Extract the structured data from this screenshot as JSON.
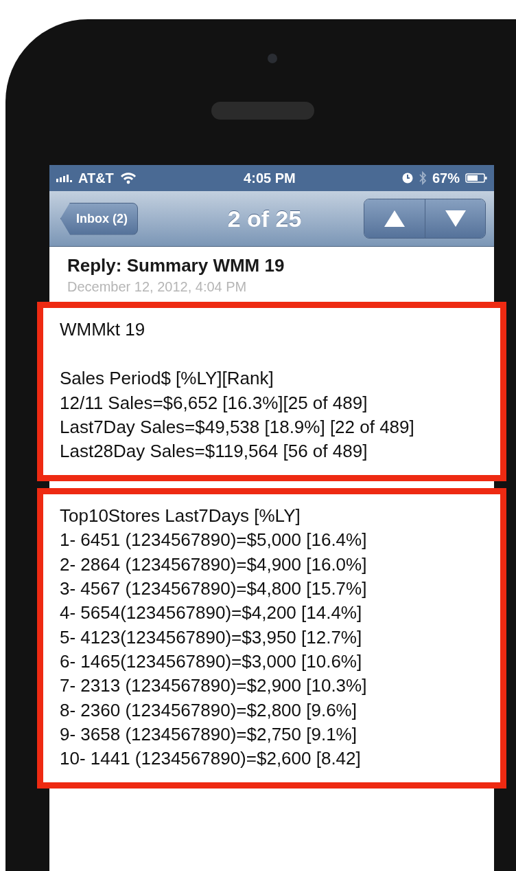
{
  "status_bar": {
    "carrier": "AT&T",
    "time": "4:05 PM",
    "battery": "67%"
  },
  "nav": {
    "back_button": "Inbox (2)",
    "title": "2 of 25"
  },
  "message": {
    "subject": "Reply: Summary WMM 19",
    "date": "December 12, 2012, 4:04 PM",
    "sections": [
      {
        "paragraphs": [
          [
            "WMMkt 19"
          ],
          [
            "Sales Period$ [%LY][Rank]",
            "12/11 Sales=$6,652 [16.3%][25 of 489]",
            "Last7Day Sales=$49,538 [18.9%] [22 of 489]",
            "Last28Day Sales=$119,564 [56 of 489]"
          ]
        ]
      },
      {
        "paragraphs": [
          [
            "Top10Stores Last7Days [%LY]",
            "1- 6451 (1234567890)=$5,000 [16.4%]",
            "2- 2864 (1234567890)=$4,900 [16.0%]",
            "3- 4567 (1234567890)=$4,800 [15.7%]",
            "4- 5654(1234567890)=$4,200 [14.4%]",
            "5- 4123(1234567890)=$3,950 [12.7%]",
            "6- 1465(1234567890)=$3,000 [10.6%]",
            "7- 2313 (1234567890)=$2,900 [10.3%]",
            "8- 2360 (1234567890)=$2,800 [9.6%]",
            "9- 3658 (1234567890)=$2,750 [9.1%]",
            "10- 1441 (1234567890)=$2,600 [8.42]"
          ]
        ]
      }
    ]
  }
}
